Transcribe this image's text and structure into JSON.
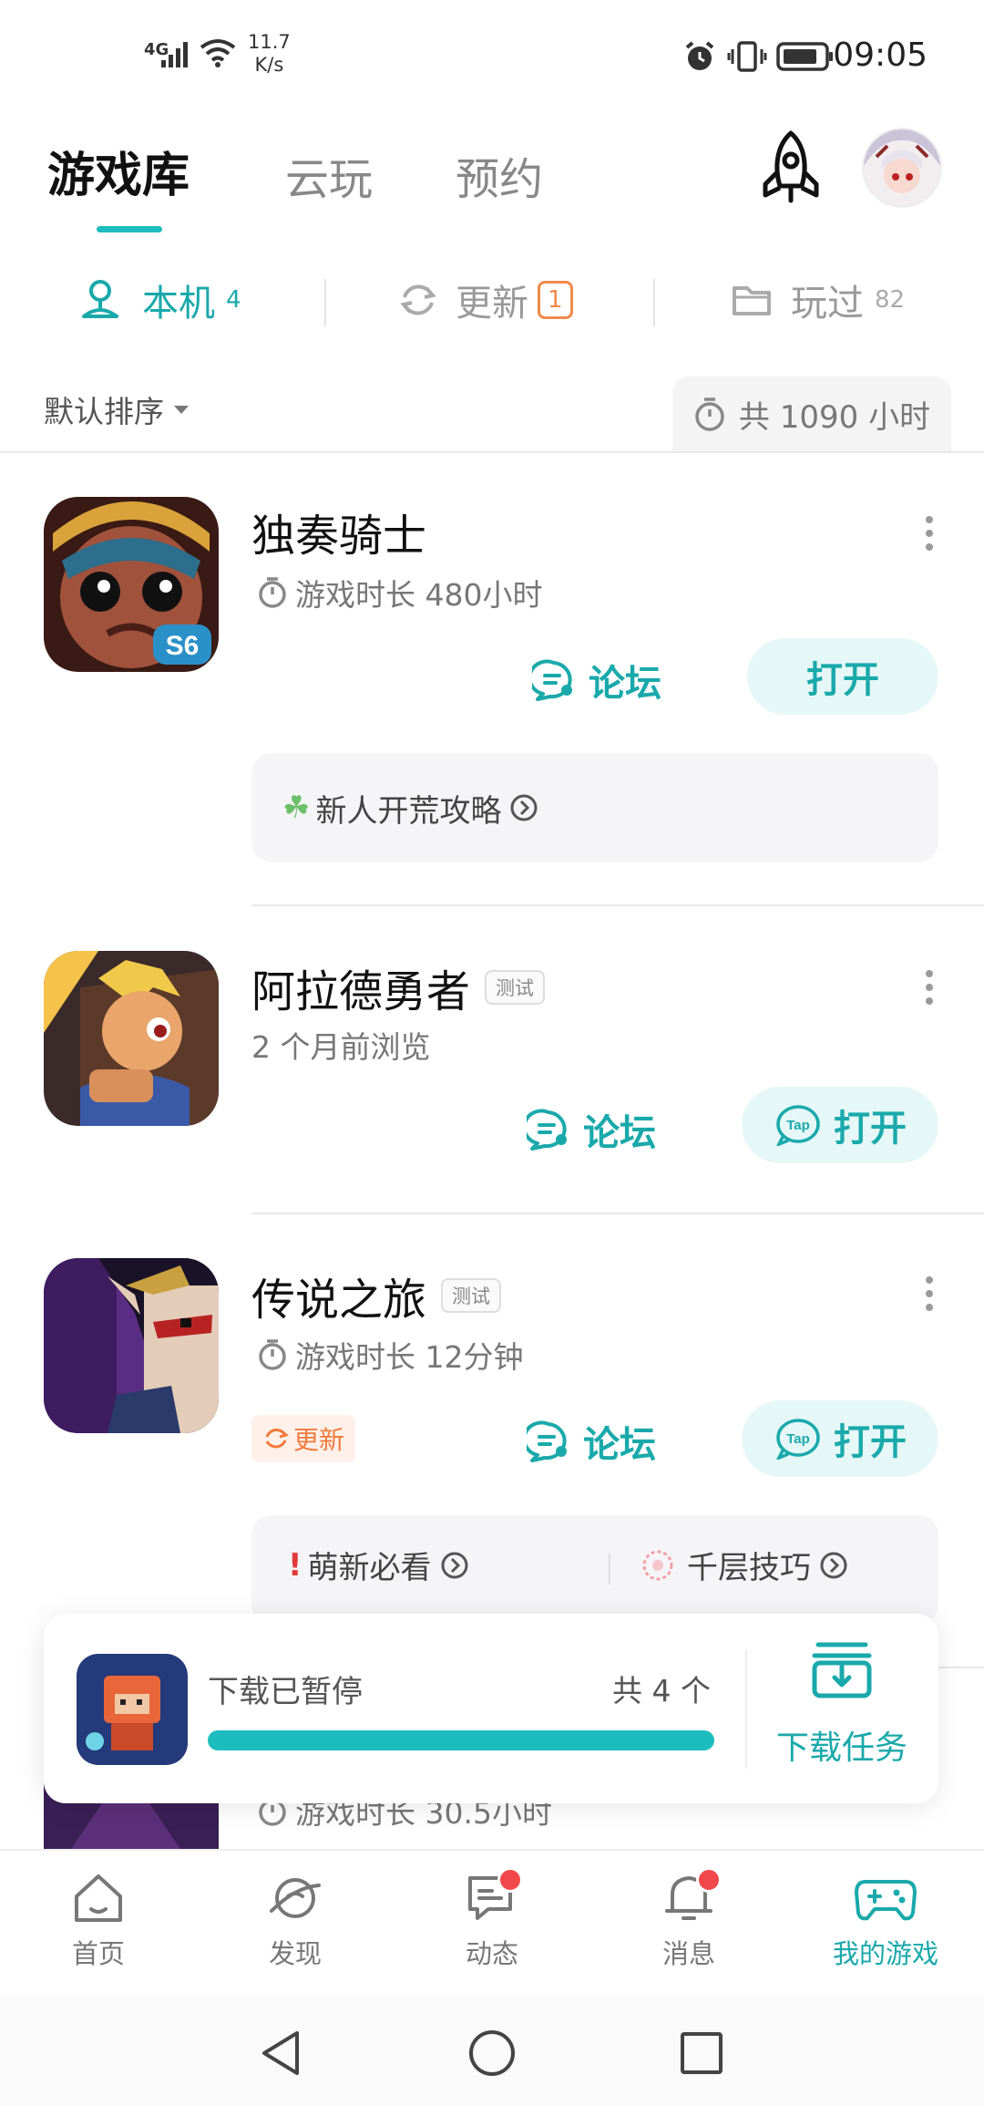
{
  "status_bar": {
    "network": "4G",
    "speed_value": "11.7",
    "speed_unit": "K/s",
    "time": "09:05"
  },
  "header": {
    "tabs": [
      {
        "label": "游戏库"
      },
      {
        "label": "云玩"
      },
      {
        "label": "预约"
      }
    ]
  },
  "subtabs": [
    {
      "label": "本机",
      "count": "4",
      "icon": "user-pin-icon"
    },
    {
      "label": "更新",
      "count": "1",
      "icon": "refresh-icon"
    },
    {
      "label": "玩过",
      "count": "82",
      "icon": "folder-icon"
    }
  ],
  "sort": {
    "label": "默认排序"
  },
  "total_playtime": "共 1090 小时",
  "games": [
    {
      "title": "独奏骑士",
      "subtitle": "游戏时长 480小时",
      "forum_label": "论坛",
      "open_label": "打开",
      "tip": "新人开荒攻略"
    },
    {
      "title": "阿拉德勇者",
      "tag": "测试",
      "subtitle": "2 个月前浏览",
      "forum_label": "论坛",
      "open_label": "打开",
      "open_badge": "Tap"
    },
    {
      "title": "传说之旅",
      "tag": "测试",
      "subtitle": "游戏时长 12分钟",
      "update_label": "更新",
      "forum_label": "论坛",
      "open_label": "打开",
      "open_badge": "Tap",
      "tips": [
        "萌新必看",
        "千层技巧"
      ]
    },
    {
      "subtitle": "游戏时长 30.5小时"
    }
  ],
  "download": {
    "status": "下载已暂停",
    "count": "共 4 个",
    "progress": 1.0,
    "task_label": "下载任务"
  },
  "bottom_nav": [
    {
      "label": "首页",
      "icon": "home-icon"
    },
    {
      "label": "发现",
      "icon": "planet-icon"
    },
    {
      "label": "动态",
      "icon": "chat-icon",
      "dot": true
    },
    {
      "label": "消息",
      "icon": "bell-icon",
      "dot": true
    },
    {
      "label": "我的游戏",
      "icon": "gamepad-icon",
      "active": true
    }
  ],
  "colors": {
    "accent": "#1dbdbf",
    "accent_text": "#1aa9ab",
    "badge_orange": "#f08a4b",
    "dot_red": "#f2484b"
  }
}
